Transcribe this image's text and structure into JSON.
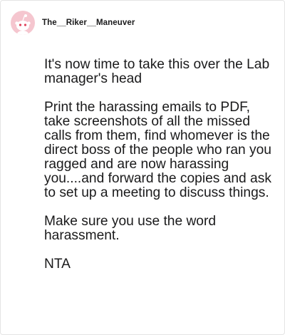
{
  "comment": {
    "username": "The__Riker__Maneuver",
    "avatar_icon": "reddit-snoo-avatar",
    "avatar_bg": "#f5c6cf",
    "paragraphs": [
      "It's now time to take this over the Lab manager's head",
      "Print the harassing emails to PDF, take screenshots of all the missed calls from them, find whomever is the direct boss of the people who ran you ragged and are now harassing you....and forward the copies and ask to set up a meeting to discuss things.",
      "Make sure you use the word harassment.",
      "NTA"
    ]
  }
}
